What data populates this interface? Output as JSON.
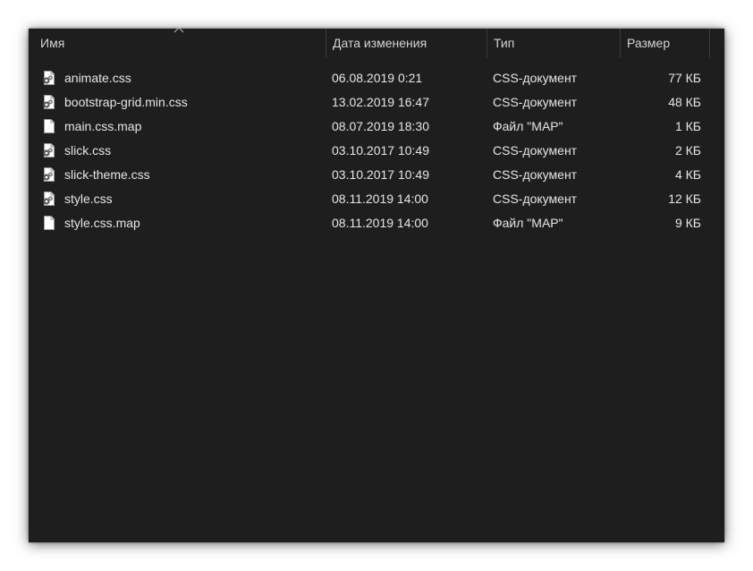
{
  "columns": {
    "name": "Имя",
    "date": "Дата изменения",
    "type": "Тип",
    "size": "Размер"
  },
  "files": [
    {
      "name": "animate.css",
      "date": "06.08.2019 0:21",
      "type": "CSS-документ",
      "size": "77 КБ",
      "icon": "css-file-icon"
    },
    {
      "name": "bootstrap-grid.min.css",
      "date": "13.02.2019 16:47",
      "type": "CSS-документ",
      "size": "48 КБ",
      "icon": "css-file-icon"
    },
    {
      "name": "main.css.map",
      "date": "08.07.2019 18:30",
      "type": "Файл \"MAP\"",
      "size": "1 КБ",
      "icon": "blank-file-icon"
    },
    {
      "name": "slick.css",
      "date": "03.10.2017 10:49",
      "type": "CSS-документ",
      "size": "2 КБ",
      "icon": "css-file-icon"
    },
    {
      "name": "slick-theme.css",
      "date": "03.10.2017 10:49",
      "type": "CSS-документ",
      "size": "4 КБ",
      "icon": "css-file-icon"
    },
    {
      "name": "style.css",
      "date": "08.11.2019 14:00",
      "type": "CSS-документ",
      "size": "12 КБ",
      "icon": "css-file-icon"
    },
    {
      "name": "style.css.map",
      "date": "08.11.2019 14:00",
      "type": "Файл \"MAP\"",
      "size": "9 КБ",
      "icon": "blank-file-icon"
    }
  ],
  "colors": {
    "background": "#1e1e1e",
    "text": "#e6e6e6",
    "header_text": "#d4d4d4",
    "divider": "#3c3c3c"
  }
}
